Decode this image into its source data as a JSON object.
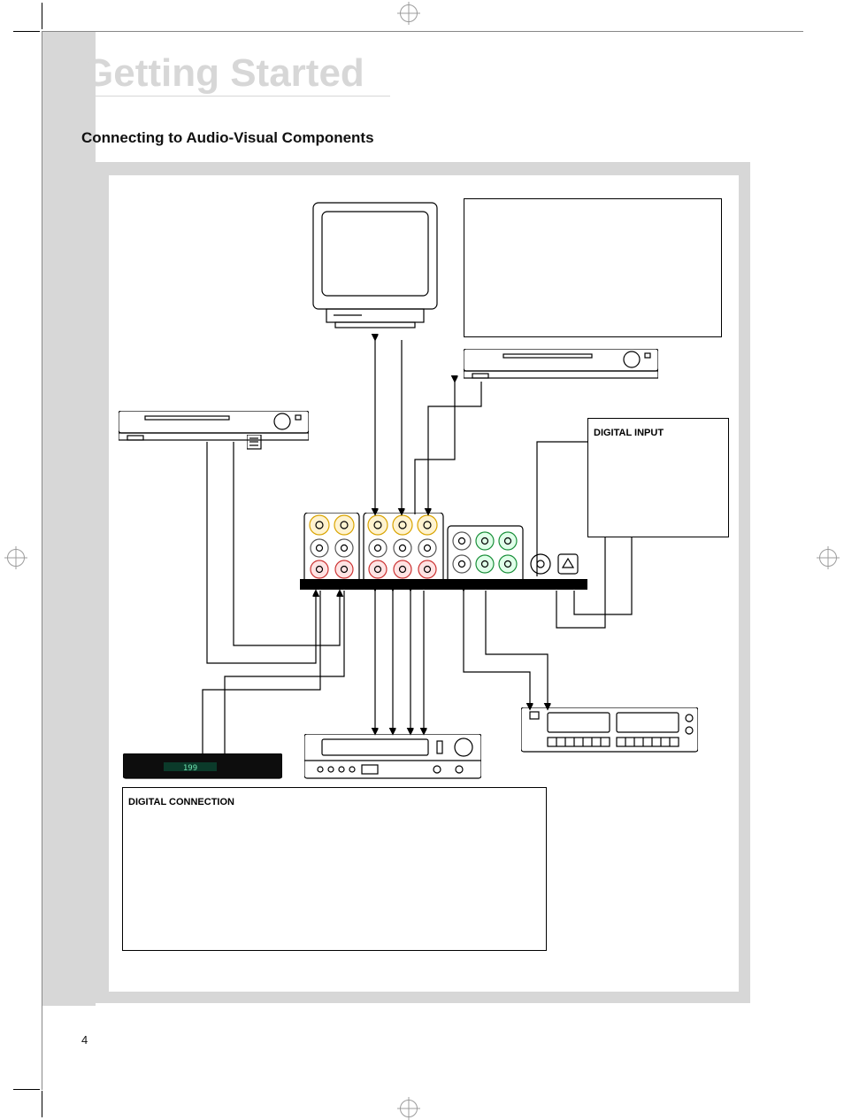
{
  "page": {
    "chapter_title": "Getting Started",
    "section_title": "Connecting to Audio-Visual Components",
    "page_number": "4"
  },
  "labels": {
    "digital_input": "DIGITAL INPUT",
    "digital_connection": "DIGITAL CONNECTION"
  }
}
